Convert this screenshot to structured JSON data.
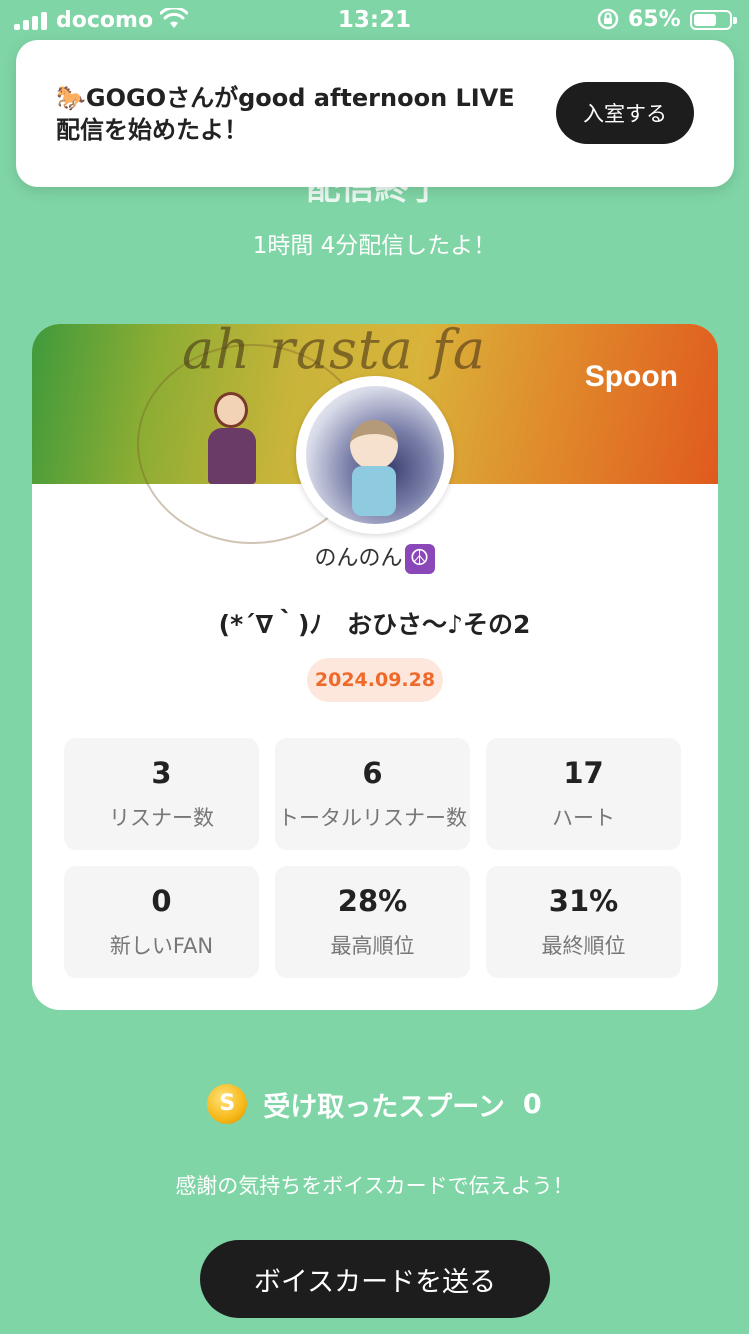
{
  "status_bar": {
    "carrier": "docomo",
    "time": "13:21",
    "battery_percent": "65%",
    "battery_level": 0.65
  },
  "banner": {
    "message": "GOGOさんがgood afternoon LIVE配信を始めたよ！",
    "enter_label": "入室する"
  },
  "header": {
    "title": "配信終了",
    "duration": "1時間 4分配信したよ！"
  },
  "card": {
    "cover_text": "ah rasta fa",
    "brand": "Spoon",
    "username": "のんのん",
    "live_title": "(*´∇｀)ﾉ　おひさ〜♪その2",
    "date": "2024.09.28",
    "stats": [
      {
        "value": "3",
        "label": "リスナー数"
      },
      {
        "value": "6",
        "label": "トータルリスナー数"
      },
      {
        "value": "17",
        "label": "ハート"
      },
      {
        "value": "0",
        "label": "新しいFAN"
      },
      {
        "value": "28%",
        "label": "最高順位"
      },
      {
        "value": "31%",
        "label": "最終順位"
      }
    ]
  },
  "spoons": {
    "label": "受け取ったスプーン",
    "count": "0"
  },
  "thanks_text": "感謝の気持ちをボイスカードで伝えよう！",
  "voice_card_button": "ボイスカードを送る",
  "colors": {
    "background": "#7fd5a6",
    "button_dark": "#1d1d1d",
    "date_accent": "#ef6a2a"
  }
}
